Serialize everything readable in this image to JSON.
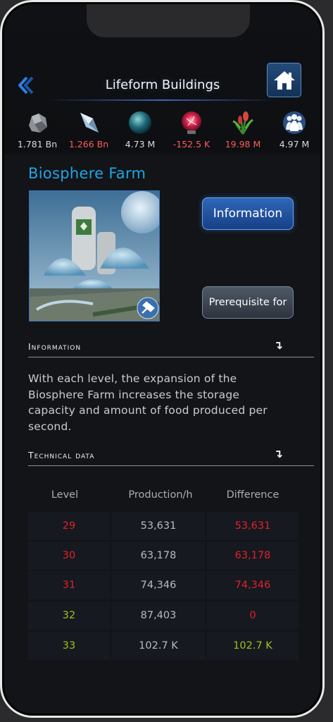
{
  "header": {
    "title": "Lifeform Buildings"
  },
  "resources": [
    {
      "icon": "metal-icon",
      "value": "1.781 Bn",
      "color": "#d9dbde"
    },
    {
      "icon": "crystal-icon",
      "value": "1.266 Bn",
      "color": "#ff5b5b"
    },
    {
      "icon": "deuterium-icon",
      "value": "4.73 M",
      "color": "#d9dbde"
    },
    {
      "icon": "energy-icon",
      "value": "-152.5 K",
      "color": "#ff5b5b"
    },
    {
      "icon": "food-icon",
      "value": "19.98 M",
      "color": "#ff5b5b"
    },
    {
      "icon": "population-icon",
      "value": "4.97 M",
      "color": "#d9dbde"
    }
  ],
  "building": {
    "name": "Biosphere Farm",
    "info_button": "Information",
    "prereq_button": "Prerequisite for"
  },
  "info_section": {
    "label": "Information",
    "text": "With each level, the expansion of the Biosphere Farm increases the storage capacity and amount of food produced per second."
  },
  "tech_section": {
    "label": "Technical data",
    "columns": [
      "Level",
      "Production/h",
      "Difference"
    ],
    "rows": [
      {
        "level": "29",
        "production": "53,631",
        "difference": "53,631",
        "level_color": "#e2202a",
        "diff_color": "#e2202a"
      },
      {
        "level": "30",
        "production": "63,178",
        "difference": "63,178",
        "level_color": "#e2202a",
        "diff_color": "#e2202a"
      },
      {
        "level": "31",
        "production": "74,346",
        "difference": "74,346",
        "level_color": "#e2202a",
        "diff_color": "#e2202a"
      },
      {
        "level": "32",
        "production": "87,403",
        "difference": "0",
        "level_color": "#9cc21e",
        "diff_color": "#e2202a"
      },
      {
        "level": "33",
        "production": "102.7 K",
        "difference": "102.7 K",
        "level_color": "#9cc21e",
        "diff_color": "#9cc21e"
      }
    ]
  },
  "colors": {
    "accent": "#21a5e3",
    "negative": "#e2202a",
    "positive": "#9cc21e"
  }
}
